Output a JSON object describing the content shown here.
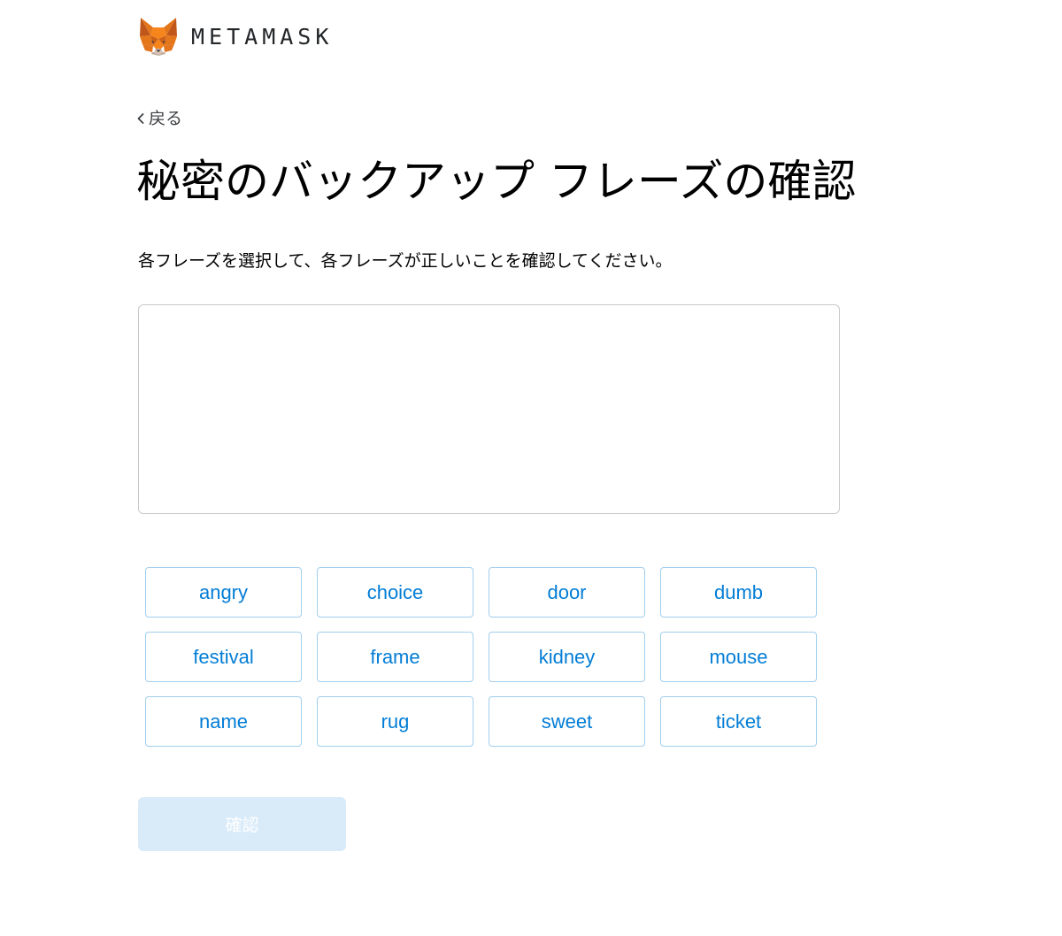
{
  "header": {
    "logo_icon": "metamask-fox-icon",
    "brand": "METAMASK"
  },
  "nav": {
    "back_icon": "chevron-left-icon",
    "back_label": "戻る"
  },
  "page": {
    "title": "秘密のバックアップ フレーズの確認",
    "instruction": "各フレーズを選択して、各フレーズが正しいことを確認してください。"
  },
  "words": [
    "angry",
    "choice",
    "door",
    "dumb",
    "festival",
    "frame",
    "kidney",
    "mouse",
    "name",
    "rug",
    "sweet",
    "ticket"
  ],
  "confirm": {
    "label": "確認",
    "disabled": true
  },
  "colors": {
    "accent": "#037dd6",
    "word_border": "#a2cfee",
    "disabled_button": "#d9ebf9",
    "fox_orange": "#e2761b"
  }
}
